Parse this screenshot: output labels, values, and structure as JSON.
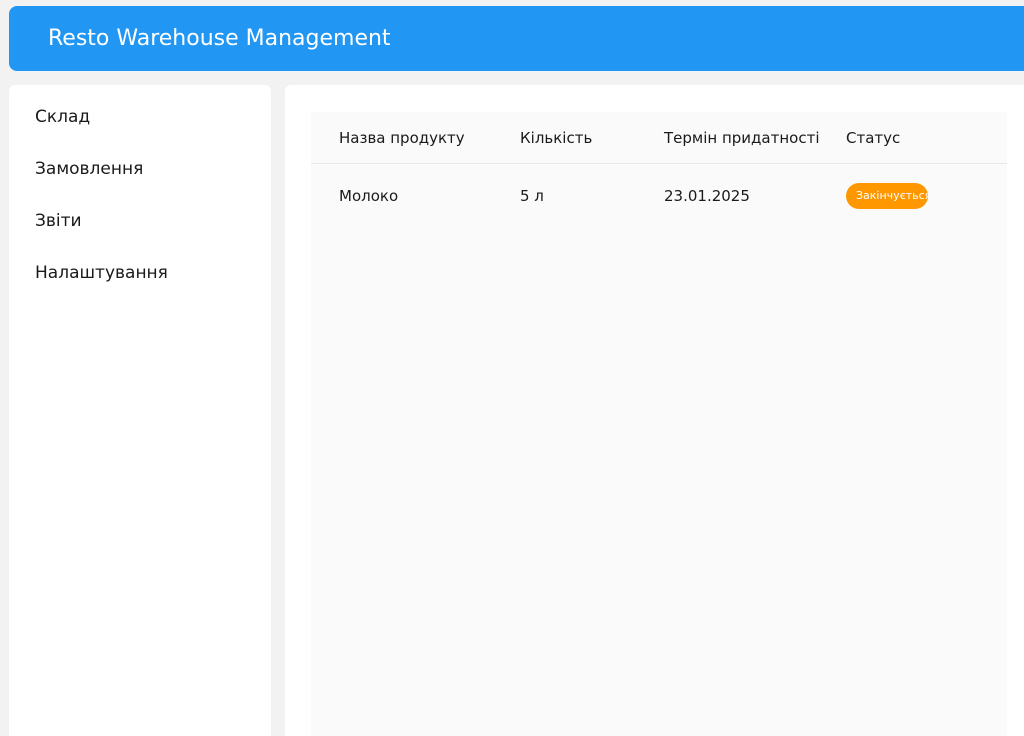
{
  "header": {
    "title": "Resto Warehouse Management"
  },
  "sidebar": {
    "items": [
      {
        "label": "Склад"
      },
      {
        "label": "Замовлення"
      },
      {
        "label": "Звіти"
      },
      {
        "label": "Налаштування"
      }
    ]
  },
  "table": {
    "columns": [
      "Назва продукту",
      "Кількість",
      "Термін придатності",
      "Статус"
    ],
    "rows": [
      {
        "name": "Молоко",
        "quantity": "5 л",
        "expiry": "23.01.2025",
        "status": "Закінчується"
      }
    ]
  },
  "colors": {
    "header_bg": "#2196f3",
    "status_warning": "#ff9800"
  }
}
